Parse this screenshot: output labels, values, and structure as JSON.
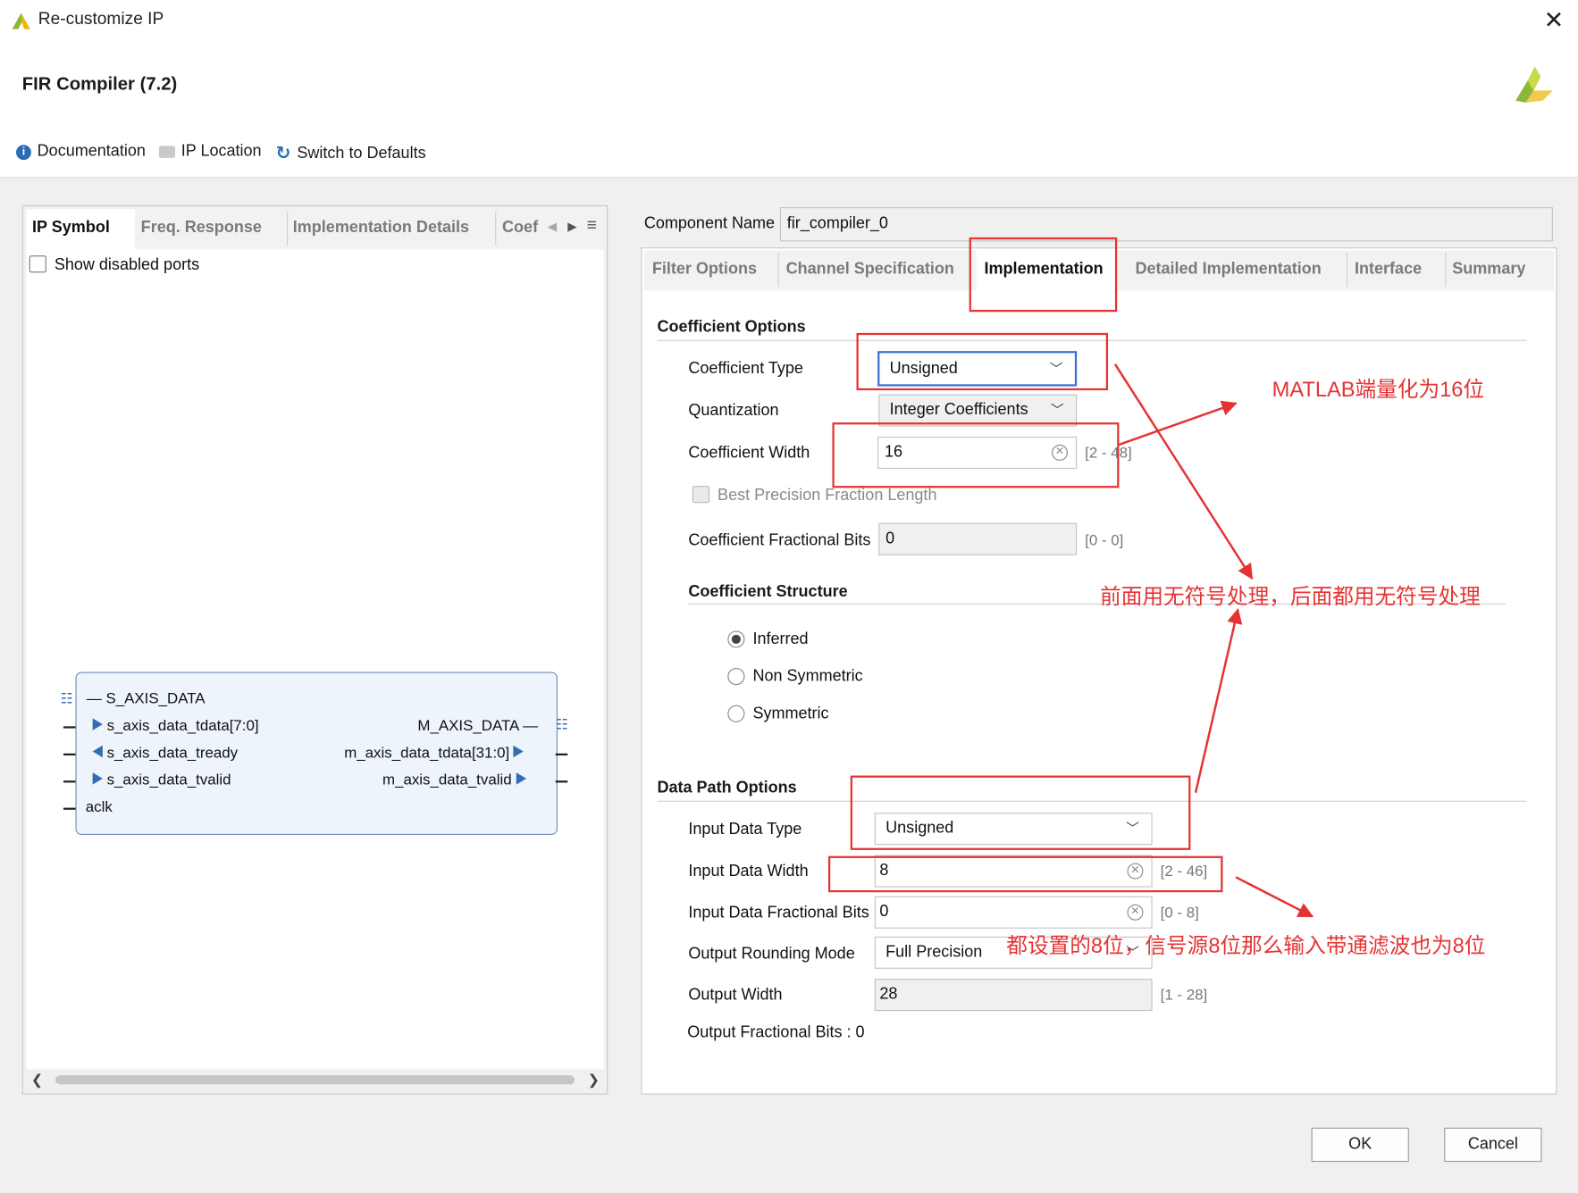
{
  "window": {
    "title": "Re-customize IP"
  },
  "header": {
    "ip_title": "FIR Compiler (7.2)",
    "toolbar": {
      "documentation": "Documentation",
      "ip_location": "IP Location",
      "switch_defaults": "Switch to Defaults"
    }
  },
  "left_panel": {
    "tabs": [
      "IP Symbol",
      "Freq. Response",
      "Implementation Details",
      "Coef"
    ],
    "show_disabled_ports": "Show disabled ports",
    "symbol": {
      "s_bus": "S_AXIS_DATA",
      "m_bus": "M_AXIS_DATA",
      "s_ports": [
        "s_axis_data_tdata[7:0]",
        "s_axis_data_tready",
        "s_axis_data_tvalid"
      ],
      "m_ports": [
        "m_axis_data_tdata[31:0]",
        "m_axis_data_tvalid"
      ],
      "clock": "aclk"
    }
  },
  "right_panel": {
    "component_name_label": "Component Name",
    "component_name": "fir_compiler_0",
    "tabs": [
      "Filter Options",
      "Channel Specification",
      "Implementation",
      "Detailed Implementation",
      "Interface",
      "Summary"
    ],
    "active_tab": "Implementation",
    "coefficient_options": {
      "heading": "Coefficient Options",
      "type_label": "Coefficient Type",
      "type_value": "Unsigned",
      "quantization_label": "Quantization",
      "quantization_value": "Integer Coefficients",
      "width_label": "Coefficient Width",
      "width_value": "16",
      "width_range": "[2 - 48]",
      "best_precision_label": "Best Precision Fraction Length",
      "frac_bits_label": "Coefficient Fractional Bits",
      "frac_bits_value": "0",
      "frac_bits_range": "[0 - 0]"
    },
    "coefficient_structure": {
      "heading": "Coefficient Structure",
      "options": [
        "Inferred",
        "Non Symmetric",
        "Symmetric"
      ],
      "selected": "Inferred"
    },
    "data_path_options": {
      "heading": "Data Path Options",
      "input_type_label": "Input Data Type",
      "input_type_value": "Unsigned",
      "input_width_label": "Input Data Width",
      "input_width_value": "8",
      "input_width_range": "[2 - 46]",
      "input_frac_label": "Input Data Fractional Bits",
      "input_frac_value": "0",
      "input_frac_range": "[0 - 8]",
      "rounding_label": "Output Rounding Mode",
      "rounding_value": "Full Precision",
      "output_width_label": "Output Width",
      "output_width_value": "28",
      "output_width_range": "[1 - 28]",
      "output_frac_text": "Output Fractional Bits : 0"
    }
  },
  "annotations": {
    "matlab_note": "MATLAB端量化为16位",
    "unsigned_note": "前面用无符号处理，后面都用无符号处理",
    "width_note": "都设置的8位，信号源8位那么输入带通滤波也为8位",
    "color": "#e53333"
  },
  "buttons": {
    "ok": "OK",
    "cancel": "Cancel"
  }
}
